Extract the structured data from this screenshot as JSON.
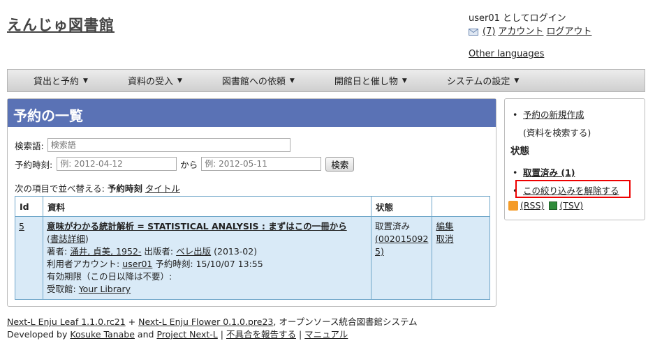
{
  "header": {
    "site_title": "えんじゅ図書館",
    "login_text": "user01 としてログイン",
    "mail_count": "(7)",
    "account_link": "アカウント",
    "logout_link": "ログアウト",
    "other_languages": "Other languages"
  },
  "nav": {
    "items": [
      {
        "label": "貸出と予約"
      },
      {
        "label": "資料の受入"
      },
      {
        "label": "図書館への依頼"
      },
      {
        "label": "開館日と催し物"
      },
      {
        "label": "システムの設定"
      }
    ]
  },
  "main": {
    "title": "予約の一覧",
    "search_label": "検索語:",
    "search_placeholder": "検索語",
    "date_label": "予約時刻:",
    "date_from_placeholder": "例: 2012-04-12",
    "date_sep": "から",
    "date_to_placeholder": "例: 2012-05-11",
    "search_button": "検索",
    "sort_prefix": "次の項目で並べ替える:",
    "sort_current": "予約時刻",
    "sort_other": "タイトル",
    "table": {
      "headers": [
        "Id",
        "資料",
        "状態",
        ""
      ],
      "row": {
        "id": "5",
        "title": "意味がわかる統計解析 = STATISTICAL ANALYSIS : まずはこの一冊から",
        "detail_link": "書誌詳細",
        "author_label": "著者:",
        "author": "涌井, 貞美, 1952-",
        "publisher_label": "出版者:",
        "publisher": "ベレ出版",
        "pub_year": "(2013-02)",
        "user_label": "利用者アカウント:",
        "user": "user01",
        "reserved_label": "予約時刻: 15/10/07 13:55",
        "expiry_text": "有効期限（この日以降は不要）:",
        "pickup_label": "受取館:",
        "pickup_library": "Your Library",
        "status": "取置済み",
        "status_code_1": "(002015092",
        "status_code_2": "5)",
        "edit_link": "編集",
        "cancel_link": "取消"
      }
    }
  },
  "sidebar": {
    "new_reservation": "予約の新規作成",
    "search_hint": "(資料を検索する)",
    "status_heading": "状態",
    "filter_current": "取置済み (1)",
    "clear_filter": "この絞り込みを解除する",
    "rss": "(RSS)",
    "tsv": "(TSV)"
  },
  "footer": {
    "leaf": "Next-L Enju Leaf 1.1.0.rc21",
    "plus": "+",
    "flower": "Next-L Enju Flower 0.1.0.pre23",
    "tagline": ", オープンソース統合図書館システム",
    "developed_by": "Developed by",
    "author": "Kosuke Tanabe",
    "and": "and",
    "project": "Project Next-L",
    "sep": "|",
    "report": "不具合を報告する",
    "manual": "マニュアル"
  },
  "colors": {
    "header_bar": "#5a72b5",
    "row_bg": "#d9eaf7",
    "highlight": "#ee0000"
  }
}
